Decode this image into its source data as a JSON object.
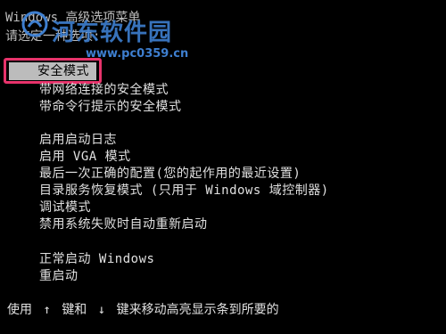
{
  "header": {
    "title": "Windows 高级选项菜单",
    "subtitle": "请选定一种选项:"
  },
  "menu": {
    "group1": [
      {
        "label": "安全模式",
        "selected": true
      },
      {
        "label": "带网络连接的安全模式"
      },
      {
        "label": "带命令行提示的安全模式"
      }
    ],
    "group2": [
      {
        "label": "启用启动日志"
      },
      {
        "label": "启用 VGA 模式"
      },
      {
        "label": "最后一次正确的配置(您的起作用的最近设置)"
      },
      {
        "label": "目录服务恢复模式 (只用于 Windows 域控制器)"
      },
      {
        "label": "调试模式"
      },
      {
        "label": "禁用系统失败时自动重新启动"
      }
    ],
    "group3": [
      {
        "label": "正常启动 Windows"
      },
      {
        "label": "重启动"
      }
    ]
  },
  "footer": {
    "part1": "使用",
    "arrow_up": "↑",
    "part2": "键和",
    "arrow_down": "↓",
    "part3": "键来移动高亮显示条到所要的"
  },
  "watermark": {
    "text": "河东软件园",
    "url": "www.pc0359.cn"
  },
  "colors": {
    "background": "#000000",
    "text": "#e0e0e0",
    "selection_bg": "#bcbcbc",
    "annotation_border": "#e8336b",
    "watermark": "#3e7fd0"
  }
}
